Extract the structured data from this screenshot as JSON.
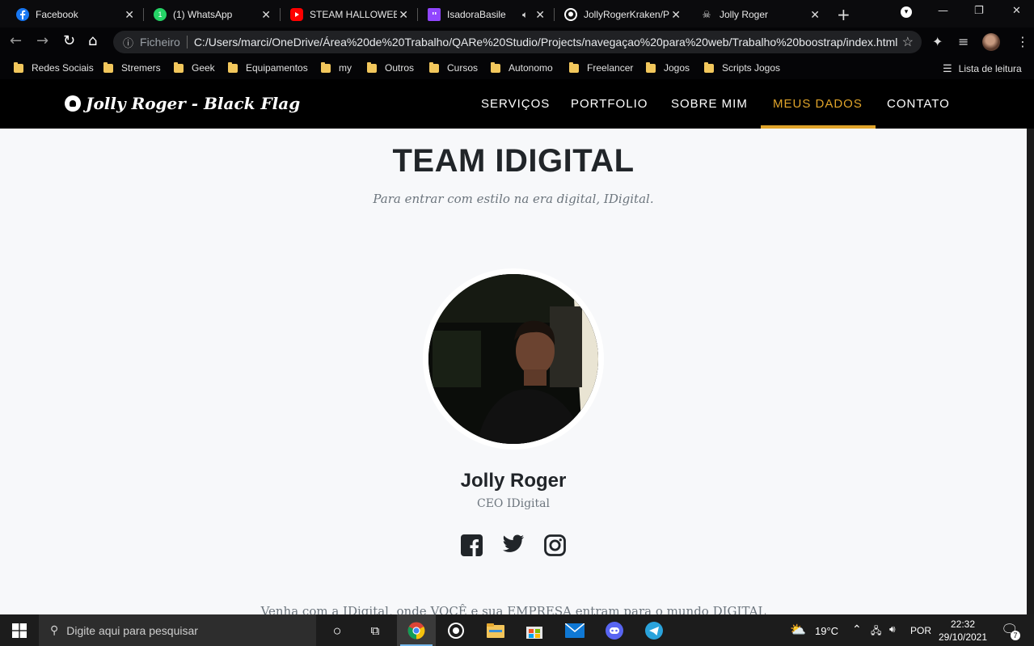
{
  "browser": {
    "tabs": [
      {
        "title": "Facebook",
        "icon": "facebook-icon"
      },
      {
        "title": "(1) WhatsApp",
        "icon": "whatsapp-icon"
      },
      {
        "title": "STEAM HALLOWEEN",
        "icon": "youtube-icon"
      },
      {
        "title": "IsadoraBasile -",
        "icon": "twitch-icon"
      },
      {
        "title": "JollyRogerKraken/P",
        "icon": "github-icon"
      },
      {
        "title": "Jolly Roger",
        "icon": "jolly-roger-icon"
      }
    ],
    "omnibox": {
      "scheme_label": "Ficheiro",
      "url": "C:/Users/marci/OneDrive/Área%20de%20Trabalho/QARe%20Studio/Projects/navegaçao%20para%20web/Trabalho%20boostrap/index.html"
    },
    "bookmarks": [
      "Redes Sociais",
      "Stremers",
      "Geek",
      "Equipamentos",
      "my",
      "Outros",
      "Cursos",
      "Autonomo",
      "Freelancer",
      "Jogos",
      "Scripts Jogos"
    ],
    "reading_list": "Lista de leitura"
  },
  "site": {
    "brand": "Jolly Roger - Black Flag",
    "nav": [
      "SERVIÇOS",
      "PORTFOLIO",
      "SOBRE MIM",
      "MEUS DADOS",
      "CONTATO"
    ],
    "active_nav": "MEUS DADOS",
    "accent_color": "#e0a42a"
  },
  "team": {
    "heading": "TEAM IDIGITAL",
    "subheading": "Para entrar com estilo na era digital, IDigital.",
    "member": {
      "name": "Jolly Roger",
      "role": "CEO IDigital",
      "socials": [
        "facebook-icon",
        "twitter-icon",
        "instagram-icon"
      ]
    },
    "footer_text": "Venha com a IDigital, onde VOCÊ e sua EMPRESA entram para o mundo DIGITAL"
  },
  "taskbar": {
    "search_placeholder": "Digite aqui para pesquisar",
    "weather": "19°C",
    "language": "POR",
    "time": "22:32",
    "date": "29/10/2021",
    "notifications": "7"
  }
}
